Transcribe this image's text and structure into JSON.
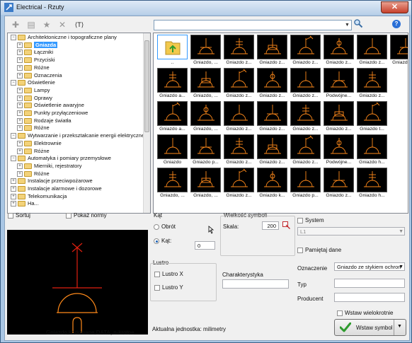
{
  "window": {
    "title": "Electrical - Rzuty",
    "close_label": "✕"
  },
  "toolbar": {
    "items": [
      {
        "name": "add-icon",
        "glyph": "✚"
      },
      {
        "name": "list-icon",
        "glyph": "▤"
      },
      {
        "name": "star-icon",
        "glyph": "★"
      },
      {
        "name": "delete-icon",
        "glyph": "✕"
      },
      {
        "name": "text-style-icon",
        "glyph": "⟨T⟩"
      }
    ],
    "search_value": "",
    "help_label": "?"
  },
  "tree": [
    {
      "label": "Architektoniczne i topograficzne plany",
      "level": 0,
      "exp": "−"
    },
    {
      "label": "Gniazda",
      "level": 1,
      "exp": "+",
      "selected": true
    },
    {
      "label": "Łączniki",
      "level": 1,
      "exp": "+"
    },
    {
      "label": "Przyciski",
      "level": 1,
      "exp": "+"
    },
    {
      "label": "Różne",
      "level": 1,
      "exp": "+"
    },
    {
      "label": "Oznaczenia",
      "level": 1,
      "exp": "+"
    },
    {
      "label": "Oświetlenie",
      "level": 0,
      "exp": "−"
    },
    {
      "label": "Lampy",
      "level": 1,
      "exp": "+"
    },
    {
      "label": "Oprawy",
      "level": 1,
      "exp": "+"
    },
    {
      "label": "Oświetlenie awaryjne",
      "level": 1,
      "exp": "+"
    },
    {
      "label": "Punkty przyłączeniowe",
      "level": 1,
      "exp": "+"
    },
    {
      "label": "Rodzaje światła",
      "level": 1,
      "exp": "+"
    },
    {
      "label": "Różne",
      "level": 1,
      "exp": "+"
    },
    {
      "label": "Wytwarzanie i przekształcanie energii elektrycznej",
      "level": 0,
      "exp": "−"
    },
    {
      "label": "Elektrownie",
      "level": 1,
      "exp": "+"
    },
    {
      "label": "Różne",
      "level": 1,
      "exp": "+"
    },
    {
      "label": "Automatyka i pomiary przemysłowe",
      "level": 0,
      "exp": "−"
    },
    {
      "label": "Mierniki, rejestratory",
      "level": 1,
      "exp": "+"
    },
    {
      "label": "Różne",
      "level": 1,
      "exp": "+"
    },
    {
      "label": "Instalacje przeciwpożarowe",
      "level": 0,
      "exp": "+"
    },
    {
      "label": "Instalacje alarmowe i dozorowe",
      "level": 0,
      "exp": "+"
    },
    {
      "label": "Telekomunikacja",
      "level": 0,
      "exp": "+"
    },
    {
      "label": "Ha...",
      "level": 0,
      "exp": "+"
    }
  ],
  "grid": [
    [
      "..",
      "Gniazdo, ...",
      "Gniazdo z...",
      "Gniazdo z...",
      "Gniazdo z...",
      "Gniazdo z...",
      "Gniazdo z...",
      "Gniazdo p..."
    ],
    [
      "Gniazdo a...",
      "Gniazdo, ...",
      "Gniazdo z...",
      "Gniazdo z...",
      "Gniazdo z...",
      "Podwójne...",
      "Gniazdo z...",
      ""
    ],
    [
      "Gniazdo a...",
      "Gniazdo, ...",
      "Gniazdo z...",
      "Gniazdo z...",
      "Gniazdo z...",
      "Gniazdo z...",
      "Gniazdo t...",
      ""
    ],
    [
      "Gniazdo",
      "Gniazdo p...",
      "Gniazdo z...",
      "Gniazdo z...",
      "Gniazdo z...",
      "Podwójne...",
      "Gniazdo h...",
      ""
    ],
    [
      "Gniazdo, ...",
      "Gniazdo, ...",
      "Gniazdo z...",
      "Gniazdo k...",
      "Gniazdo p...",
      "Gniazdo z...",
      "Gniazdo h...",
      ""
    ]
  ],
  "options": {
    "sort_label": "Sortuj",
    "show_norms_label": "Pokaż normy"
  },
  "preview": {
    "caption": "Gniazdo kodowane DATA, n-krotne"
  },
  "angle": {
    "title": "Kąt",
    "rotate_label": "Obrót",
    "angle_label": "Kąt:",
    "angle_value": "0"
  },
  "scale": {
    "title": "Wielkość symboli",
    "scale_label": "Skala:",
    "scale_value": "200"
  },
  "system": {
    "label": "System",
    "value": "L1"
  },
  "mirror": {
    "title": "Lustro",
    "x_label": "Lustro X",
    "y_label": "Lustro Y"
  },
  "characteristic": {
    "label": "Charakterystyka",
    "value": ""
  },
  "remember": {
    "label": "Pamiętaj dane"
  },
  "designation": {
    "label": "Oznaczenie",
    "value": "Gniazdo ze stykiem ochron"
  },
  "type": {
    "label": "Typ",
    "value": ""
  },
  "producer": {
    "label": "Producent",
    "value": ""
  },
  "multi_insert": {
    "label": "Wstaw wielokrotnie"
  },
  "insert": {
    "label": "Wstaw symbol"
  },
  "status": {
    "unit_text": "Aktualna jednostka: milimetry"
  },
  "colors": {
    "accent": "#3399ff",
    "symbol": "#ff8a1a",
    "preview_red": "#e02010"
  }
}
